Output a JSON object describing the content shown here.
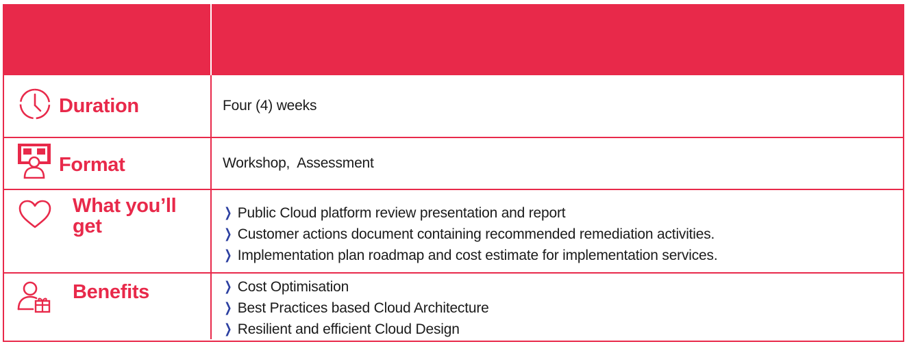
{
  "header": {
    "col1": "",
    "col2": ""
  },
  "rows": [
    {
      "icon": "clock-icon",
      "label": "Duration",
      "value": "Four (4) weeks"
    },
    {
      "icon": "presenter-board-icon",
      "label": "Format",
      "value": "Workshop,  Assessment"
    },
    {
      "icon": "heart-icon",
      "label_line1": "What you’ll",
      "label_line2": "get",
      "items": [
        "Public Cloud platform review presentation and report",
        "Customer actions document containing recommended remediation activities.",
        "Implementation plan roadmap and cost estimate for implementation services."
      ]
    },
    {
      "icon": "person-gift-icon",
      "label": "Benefits",
      "items": [
        "Cost Optimisation",
        "Best Practices based Cloud Architecture",
        "Resilient and efficient Cloud Design"
      ]
    }
  ],
  "colors": {
    "accent": "#e8294a",
    "bullet": "#2b3fa0",
    "text": "#1a1a1a"
  }
}
